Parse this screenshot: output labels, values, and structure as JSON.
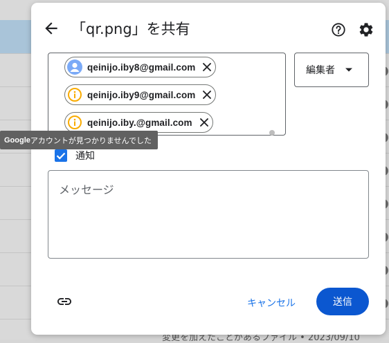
{
  "dialog": {
    "title": "「qr.png」を共有",
    "back_icon": "arrow-back-icon",
    "help_icon": "help-icon",
    "settings_icon": "gear-icon"
  },
  "recipients": [
    {
      "email": "qeinijo.iby8@gmail.com",
      "icon": "person-avatar-icon",
      "status": "found"
    },
    {
      "email": "qeinijo.iby9@gmail.com",
      "icon": "info-warning-icon",
      "status": "not_found"
    },
    {
      "email": "qeinijo.iby.@gmail.com",
      "icon": "info-warning-icon",
      "status": "not_found"
    }
  ],
  "tooltip": {
    "brand": "Google",
    "text": " アカウントが見つかりませんでした"
  },
  "role": {
    "selected": "編集者"
  },
  "notify": {
    "label": "通知",
    "checked": true
  },
  "message": {
    "placeholder": "メッセージ",
    "value": ""
  },
  "actions": {
    "cancel_label": "キャンセル",
    "send_label": "送信",
    "link_icon": "link-icon"
  },
  "background": {
    "footer_text": "変更を加えたことがあるファイル • 2023/09/10"
  },
  "colors": {
    "accent": "#1a73e8",
    "send_button": "#0b57d0",
    "warning": "#f9ab00",
    "avatar": "#7baaf7",
    "tooltip_bg": "#616161"
  }
}
